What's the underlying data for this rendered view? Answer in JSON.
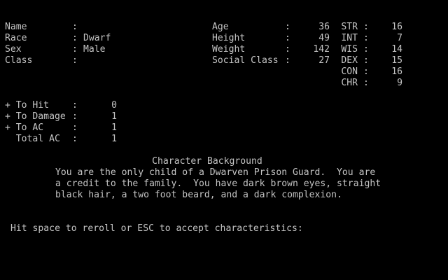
{
  "character": {
    "name": {
      "label": "Name",
      "sep": ":",
      "value": ""
    },
    "race": {
      "label": "Race",
      "sep": ":",
      "value": "Dwarf"
    },
    "sex": {
      "label": "Sex",
      "sep": ":",
      "value": "Male"
    },
    "class": {
      "label": "Class",
      "sep": ":",
      "value": ""
    }
  },
  "physical": {
    "age": {
      "label": "Age",
      "sep": ":",
      "value": "36"
    },
    "height": {
      "label": "Height",
      "sep": ":",
      "value": "49"
    },
    "weight": {
      "label": "Weight",
      "sep": ":",
      "value": "142"
    },
    "social_class": {
      "label": "Social Class",
      "sep": ":",
      "value": "27"
    }
  },
  "attributes": [
    {
      "label": "STR",
      "sep": ":",
      "value": "16"
    },
    {
      "label": "INT",
      "sep": ":",
      "value": "7"
    },
    {
      "label": "WIS",
      "sep": ":",
      "value": "14"
    },
    {
      "label": "DEX",
      "sep": ":",
      "value": "15"
    },
    {
      "label": "CON",
      "sep": ":",
      "value": "16"
    },
    {
      "label": "CHR",
      "sep": ":",
      "value": "9"
    }
  ],
  "combat": [
    {
      "label": "+ To Hit",
      "sep": ":",
      "value": "0"
    },
    {
      "label": "+ To Damage",
      "sep": ":",
      "value": "1"
    },
    {
      "label": "+ To AC",
      "sep": ":",
      "value": "1"
    },
    {
      "label": "  Total AC",
      "sep": ":",
      "value": "1"
    }
  ],
  "background": {
    "title": "Character Background",
    "lines": [
      "You are the only child of a Dwarven Prison Guard.  You are",
      "a credit to the family.  You have dark brown eyes, straight",
      "black hair, a two foot beard, and a dark complexion."
    ]
  },
  "prompt": "Hit space to reroll or ESC to accept characteristics:"
}
